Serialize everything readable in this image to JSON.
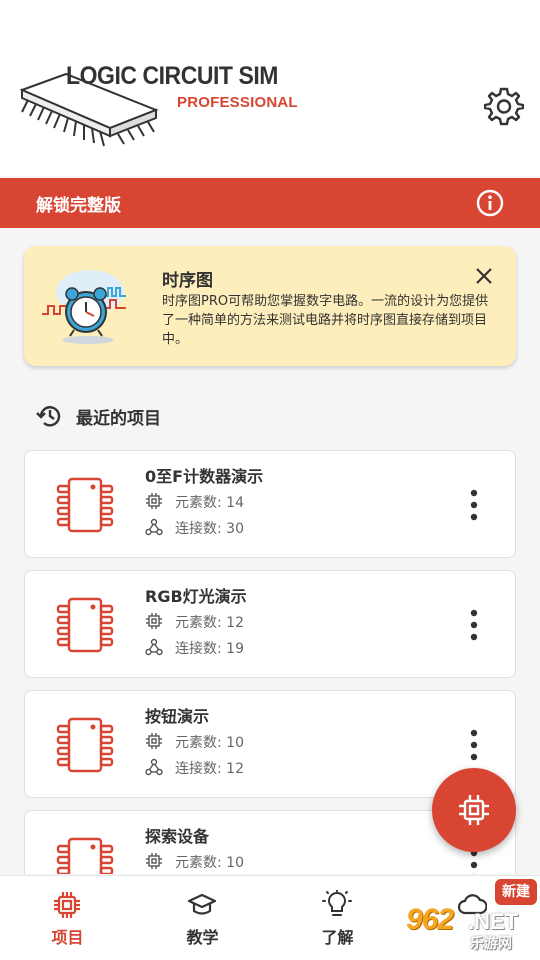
{
  "header": {
    "logo_title": "LOGIC CIRCUIT SIM",
    "logo_subtitle": "PROFESSIONAL"
  },
  "unlock_bar": {
    "label": "解锁完整版"
  },
  "promo": {
    "title": "时序图",
    "description": "时序图PRO可帮助您掌握数字电路。一流的设计为您提供了一种简单的方法来测试电路并将时序图直接存储到项目中。"
  },
  "recent": {
    "label": "最近的项目"
  },
  "projects": [
    {
      "name": "0至F计数器演示",
      "elements": "元素数: 14",
      "connections": "连接数: 30"
    },
    {
      "name": "RGB灯光演示",
      "elements": "元素数: 12",
      "connections": "连接数: 19"
    },
    {
      "name": "按钮演示",
      "elements": "元素数: 10",
      "connections": "连接数: 12"
    },
    {
      "name": "探索设备",
      "elements": "元素数: 10",
      "connections": ""
    }
  ],
  "nav": {
    "items": [
      {
        "label": "项目",
        "icon": "chip-icon",
        "active": true
      },
      {
        "label": "教学",
        "icon": "graduation-cap-icon",
        "active": false
      },
      {
        "label": "了解",
        "icon": "lightbulb-icon",
        "active": false
      },
      {
        "label": "",
        "icon": "cloud-icon",
        "active": false
      }
    ],
    "new_badge": "新建"
  },
  "watermark": {
    "number": "962",
    "domain": ".NET",
    "site": "乐游网"
  },
  "colors": {
    "accent": "#d84532",
    "promo_bg": "#fdeebb",
    "background": "#f5f5f5"
  }
}
